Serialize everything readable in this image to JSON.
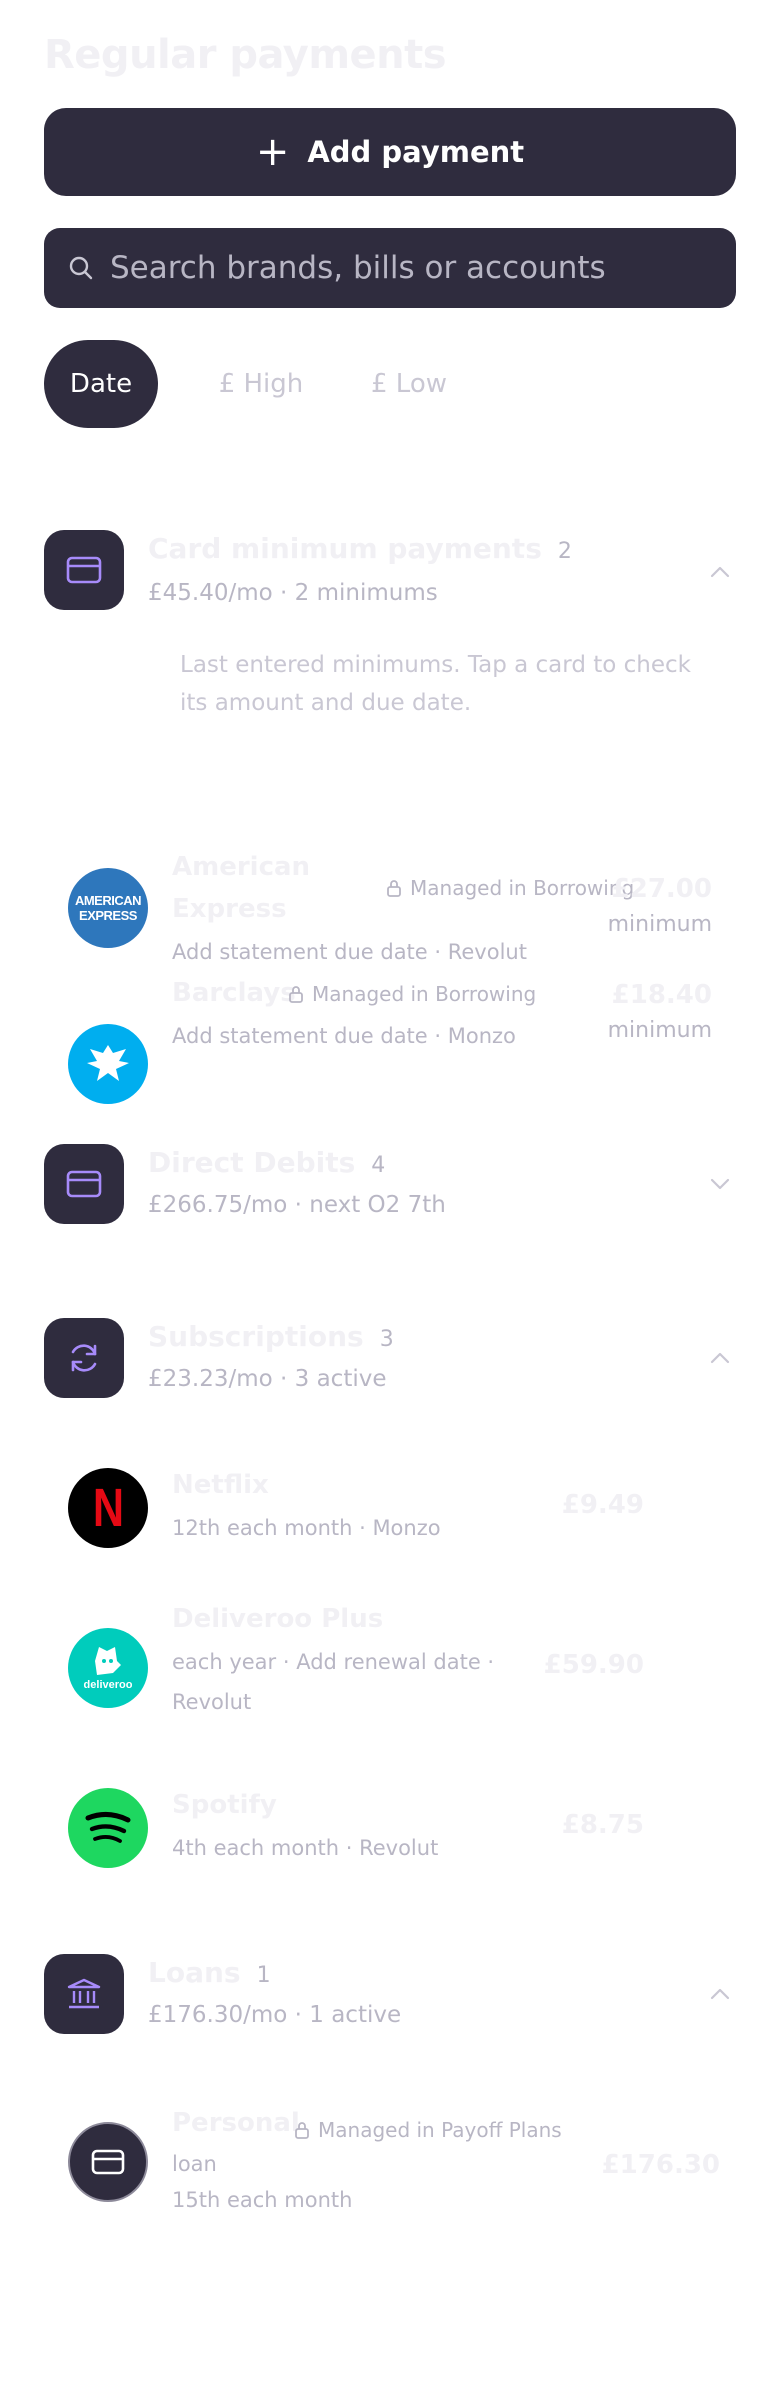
{
  "header": {
    "title": "Regular payments"
  },
  "actions": {
    "add_label": "Add payment"
  },
  "search": {
    "placeholder": "Search brands, bills or accounts"
  },
  "sort": {
    "options": [
      "Date",
      "£ High",
      "£ Low"
    ],
    "selected": "Date"
  },
  "groups": {
    "card_minimums": {
      "title": "Card minimum payments",
      "count": "2",
      "summary": "£45.40/mo · 2 minimums",
      "expanded": true,
      "note": "Last entered minimums. Tap a card to check its amount and due date.",
      "items": [
        {
          "name_line1": "American",
          "name_line2": "Express",
          "logo_text": "AMERICAN EXPRESS",
          "managed": "Managed in Borrowing",
          "sub": "Add statement due date  ·  Revolut",
          "amount": "£27.00",
          "amount_sub": "minimum"
        },
        {
          "name_line1": "Barclays",
          "managed": "Managed in Borrowing",
          "sub": "Add statement due date  ·  Monzo",
          "amount": "£18.40",
          "amount_sub": "minimum"
        }
      ]
    },
    "direct_debits": {
      "title": "Direct Debits",
      "count": "4",
      "summary": "£266.75/mo · next O2 7th",
      "expanded": false
    },
    "subscriptions": {
      "title": "Subscriptions",
      "count": "3",
      "summary": "£23.23/mo · 3 active",
      "expanded": true,
      "items": [
        {
          "name": "Netflix",
          "logo_text": "N",
          "sub": "12th each month  ·  Monzo",
          "amount": "£9.49"
        },
        {
          "name": "Deliveroo Plus",
          "logo_text": "deliveroo",
          "sub_line1": "each year · Add renewal date  ·",
          "sub_line2": "Revolut",
          "amount": "£59.90"
        },
        {
          "name": "Spotify",
          "sub": "4th each month  ·  Revolut",
          "amount": "£8.75"
        }
      ]
    },
    "loans": {
      "title": "Loans",
      "count": "1",
      "summary": "£176.30/mo · 1 active",
      "expanded": true,
      "items": [
        {
          "name_line1": "Personal",
          "name_line2": "loan",
          "managed": "Managed in Payoff Plans",
          "sub": "15th each month",
          "amount": "£176.30"
        }
      ]
    }
  },
  "colors": {
    "dark": "#2f2c3e",
    "accent": "#a78bfa",
    "amex": "#2e77bc",
    "barclays": "#00aeef",
    "deliveroo": "#00ccbc",
    "spotify": "#1ed760",
    "netflix_red": "#e50914"
  }
}
